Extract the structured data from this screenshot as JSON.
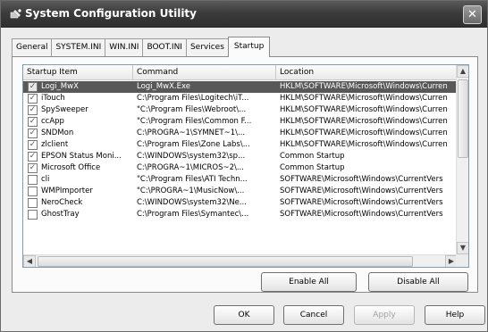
{
  "window": {
    "title": "System Configuration Utility",
    "close_glyph": "✕"
  },
  "tabs": [
    {
      "label": "General"
    },
    {
      "label": "SYSTEM.INI"
    },
    {
      "label": "WIN.INI"
    },
    {
      "label": "BOOT.INI"
    },
    {
      "label": "Services"
    },
    {
      "label": "Startup",
      "active": true
    }
  ],
  "list": {
    "columns": [
      "Startup Item",
      "Command",
      "Location"
    ],
    "rows": [
      {
        "checked": true,
        "item": "Logi_MwX",
        "command": "Logi_MwX.Exe",
        "location": "HKLM\\SOFTWARE\\Microsoft\\Windows\\Curren",
        "selected": true
      },
      {
        "checked": true,
        "item": "iTouch",
        "command": "C:\\Program Files\\Logitech\\iT...",
        "location": "HKLM\\SOFTWARE\\Microsoft\\Windows\\Curren"
      },
      {
        "checked": true,
        "item": "SpySweeper",
        "command": "\"C:\\Program Files\\Webroot\\...",
        "location": "HKLM\\SOFTWARE\\Microsoft\\Windows\\Curren"
      },
      {
        "checked": true,
        "item": "ccApp",
        "command": "\"C:\\Program Files\\Common F...",
        "location": "HKLM\\SOFTWARE\\Microsoft\\Windows\\Curren"
      },
      {
        "checked": true,
        "item": "SNDMon",
        "command": "C:\\PROGRA~1\\SYMNET~1\\...",
        "location": "HKLM\\SOFTWARE\\Microsoft\\Windows\\Curren"
      },
      {
        "checked": true,
        "item": "zlclient",
        "command": "C:\\Program Files\\Zone Labs\\...",
        "location": "HKLM\\SOFTWARE\\Microsoft\\Windows\\Curren"
      },
      {
        "checked": true,
        "item": "EPSON Status Moni...",
        "command": "C:\\WINDOWS\\system32\\sp...",
        "location": "Common Startup"
      },
      {
        "checked": true,
        "item": "Microsoft Office",
        "command": "C:\\PROGRA~1\\MICROS~2\\...",
        "location": "Common Startup"
      },
      {
        "checked": false,
        "item": "cli",
        "command": "\"C:\\Program Files\\ATI Techn...",
        "location": "SOFTWARE\\Microsoft\\Windows\\CurrentVers"
      },
      {
        "checked": false,
        "item": "WMPImporter",
        "command": "\"C:\\PROGRA~1\\MusicNow\\...",
        "location": "SOFTWARE\\Microsoft\\Windows\\CurrentVers"
      },
      {
        "checked": false,
        "item": "NeroCheck",
        "command": "C:\\WINDOWS\\system32\\Ne...",
        "location": "SOFTWARE\\Microsoft\\Windows\\CurrentVers"
      },
      {
        "checked": false,
        "item": "GhostTray",
        "command": "C:\\Program Files\\Symantec\\...",
        "location": "SOFTWARE\\Microsoft\\Windows\\CurrentVers"
      }
    ]
  },
  "scroll": {
    "up": "▲",
    "down": "▼",
    "left": "◀",
    "right": "▶"
  },
  "buttons": {
    "enable_all": "Enable All",
    "disable_all": "Disable All",
    "ok": "OK",
    "cancel": "Cancel",
    "apply": "Apply",
    "help": "Help"
  },
  "colors": {
    "title_bar": "#3b3b3b",
    "selected_row": "#585858"
  },
  "icons": {
    "title": "system-config-icon",
    "check": "✓"
  }
}
